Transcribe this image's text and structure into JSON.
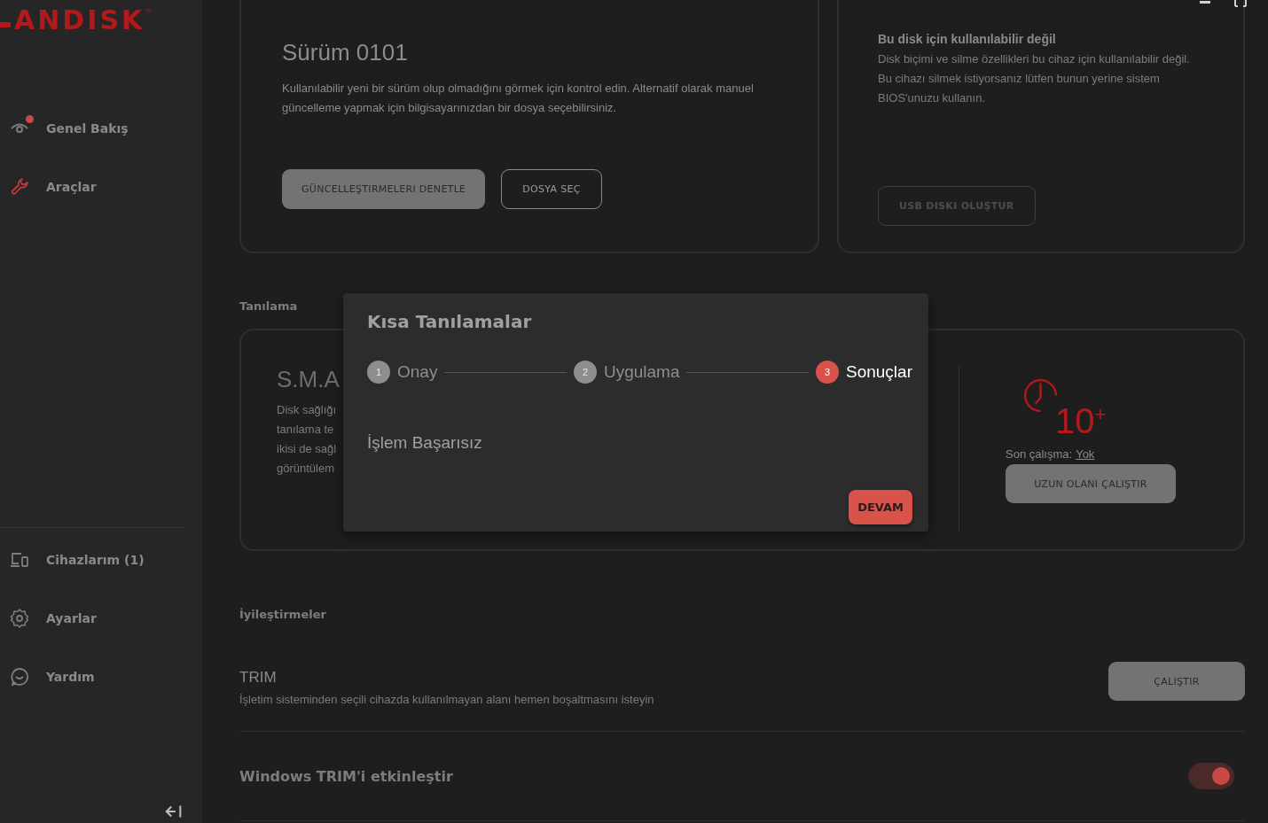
{
  "sidebar": {
    "logo": "ANDISK",
    "logo_mark": "™",
    "top_items": [
      {
        "label": "Genel Bakış",
        "kind": "eye",
        "badge": true,
        "selected": false
      },
      {
        "label": "Araçlar",
        "kind": "wrench",
        "badge": false,
        "selected": true
      }
    ],
    "bottom_items": [
      {
        "label": "Cihazlarım (1)",
        "kind": "devices",
        "badge": false,
        "selected": false
      },
      {
        "label": "Ayarlar",
        "kind": "gear",
        "badge": false,
        "selected": false
      },
      {
        "label": "Yardım",
        "kind": "help",
        "badge": false,
        "selected": false
      }
    ]
  },
  "firmware_card": {
    "title": "Sürüm 0101",
    "text": "Kullanılabilir yeni bir sürüm olup olmadığını görmek için kontrol edin. Alternatif olarak manuel güncelleme yapmak için bilgisayarınızdan bir dosya seçebilirsiniz.",
    "buttons": [
      {
        "label": "GÜNCELLEŞTIRMELERI DENETLE",
        "kind": "filled",
        "disabled": false
      },
      {
        "label": "DOSYA SEÇ",
        "kind": "outlined",
        "disabled": false
      }
    ]
  },
  "format_card": {
    "title": "Bu disk için kullanılabilir değil",
    "text": "Disk biçimi ve silme özellikleri bu cihaz için kullanılabilir değil. Bu cihazı silmek istiyorsanız lütfen bunun yerine sistem BIOS'unuzu kullanın.",
    "buttons": [
      {
        "label": "USB DISKI OLUŞTUR",
        "kind": "outlined",
        "disabled": true
      }
    ]
  },
  "diagnostics": {
    "section_title": "Tanılama",
    "smart_title": "S.M.A",
    "smart_text_lines": [
      "Disk sağlığı",
      "tanılama te",
      "ikisi de sağl",
      "görüntülem"
    ],
    "long_test": {
      "icon_text": "10$^{+}$",
      "last_run_label": "Son çalışma:",
      "last_run_value": "Yok",
      "button": "UZUN OLANI ÇALIŞTIR"
    }
  },
  "dialog": {
    "title": "Kısa Tanılamalar",
    "steps": [
      {
        "number": "1",
        "label": "Onay",
        "selected": false
      },
      {
        "number": "2",
        "label": "Uygulama",
        "selected": false
      },
      {
        "number": "3",
        "label": "Sonuçlar",
        "selected": true
      }
    ],
    "message": "İşlem Başarısız",
    "button": "DEVAM"
  },
  "optimizations": {
    "section_title": "İyileştirmeler",
    "trim": {
      "title": "TRIM",
      "text": "İşletim sisteminden seçili cihazda kullanılmayan alanı hemen boşaltmasını isteyin",
      "button": "ÇALIŞTIR"
    },
    "windows_trim": {
      "label": "Windows TRIM'i etkinleştir",
      "on": true
    }
  }
}
